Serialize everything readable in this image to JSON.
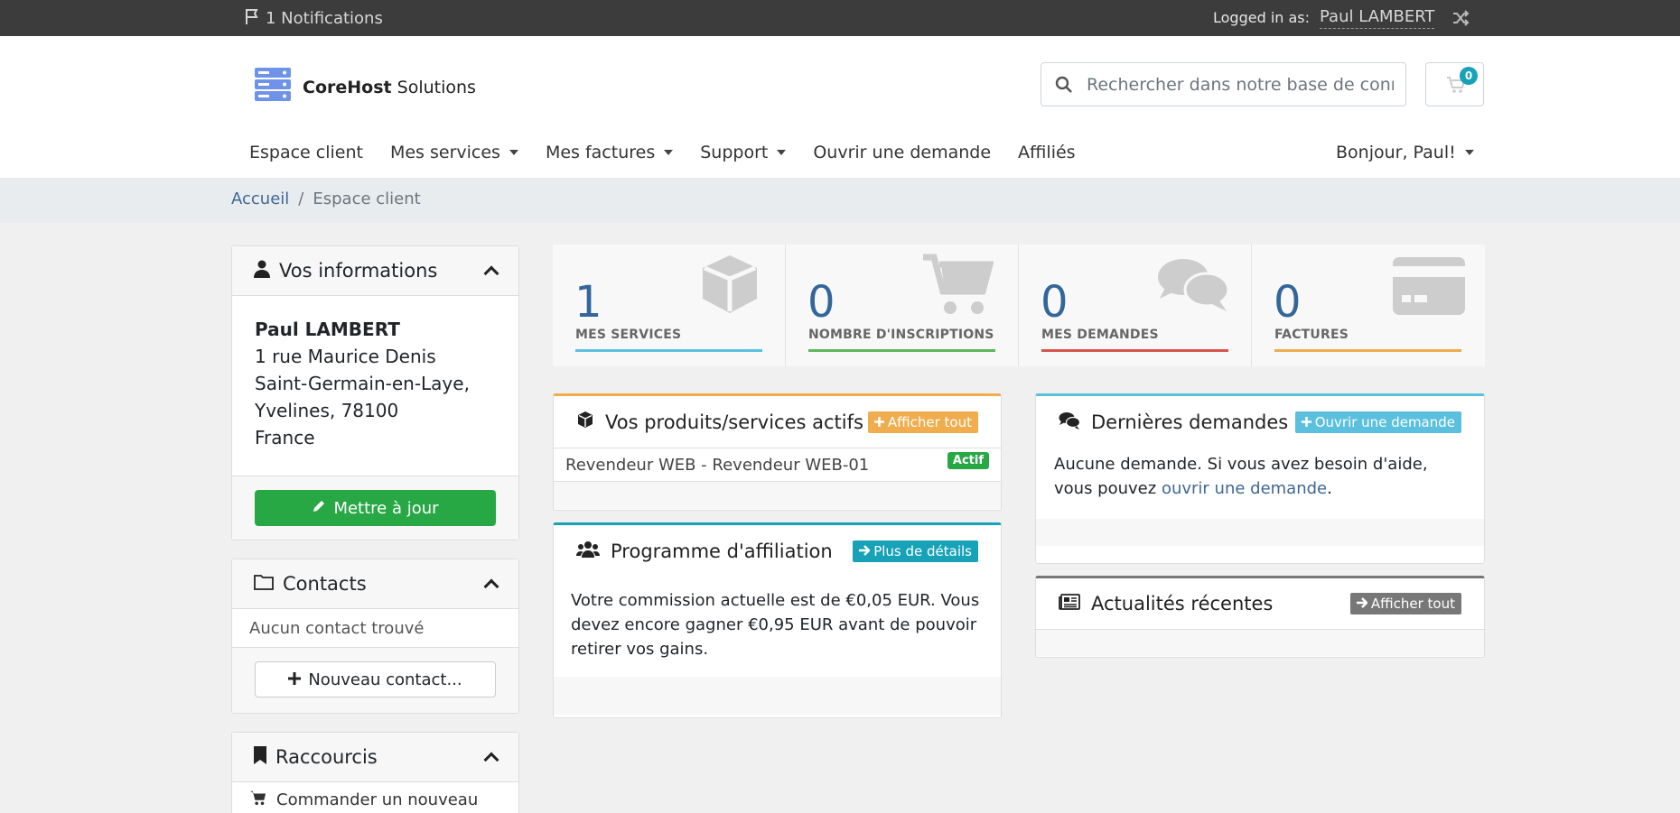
{
  "topbar": {
    "notifications": "1 Notifications",
    "logged_in_label": "Logged in as:",
    "username": "Paul LAMBERT"
  },
  "brand": {
    "name_bold": "CoreHost",
    "name_rest": "Solutions"
  },
  "search": {
    "placeholder": "Rechercher dans notre base de connaissances..."
  },
  "cart": {
    "count": "0"
  },
  "nav": {
    "items": [
      "Espace client",
      "Mes services",
      "Mes factures",
      "Support",
      "Ouvrir une demande",
      "Affiliés"
    ],
    "greeting": "Bonjour, Paul!"
  },
  "breadcrumb": {
    "home": "Accueil",
    "separator": "/",
    "current": "Espace client"
  },
  "sidebar": {
    "info": {
      "title": "Vos informations",
      "name": "Paul LAMBERT",
      "address1": "1 rue Maurice Denis",
      "city": "Saint-Germain-en-Laye,",
      "region": "Yvelines, 78100",
      "country": "France",
      "update_button": "Mettre à jour"
    },
    "contacts": {
      "title": "Contacts",
      "empty": "Aucun contact trouvé",
      "new_button": "Nouveau contact..."
    },
    "shortcuts": {
      "title": "Raccourcis",
      "first_item": "Commander un nouveau"
    }
  },
  "tiles": [
    {
      "value": "1",
      "label": "MES SERVICES",
      "color": "#5bc0de"
    },
    {
      "value": "0",
      "label": "NOMBRE D'INSCRIPTIONS",
      "color": "#5cb85c"
    },
    {
      "value": "0",
      "label": "MES DEMANDES",
      "color": "#d9534f"
    },
    {
      "value": "0",
      "label": "FACTURES",
      "color": "#f0ad4e"
    }
  ],
  "products": {
    "title": "Vos produits/services actifs",
    "view_all": "Afficher tout",
    "accent": "#f0ad4e",
    "row_name": "Revendeur WEB - Revendeur WEB-01",
    "row_status": "Actif"
  },
  "affiliate": {
    "title": "Programme d'affiliation",
    "details_button": "Plus de détails",
    "accent": "#17a2b8",
    "text": "Votre commission actuelle est de €0,05 EUR. Vous devez encore gagner €0,95 EUR avant de pouvoir retirer vos gains."
  },
  "tickets": {
    "title": "Dernières demandes",
    "open_button": "Ouvrir une demande",
    "accent": "#5bc0de",
    "text_before": "Aucune demande. Si vous avez besoin d'aide, vous pouvez",
    "link": "ouvrir une demande",
    "text_after": "."
  },
  "news": {
    "title": "Actualités récentes",
    "view_all": "Afficher tout",
    "accent": "#777777"
  }
}
